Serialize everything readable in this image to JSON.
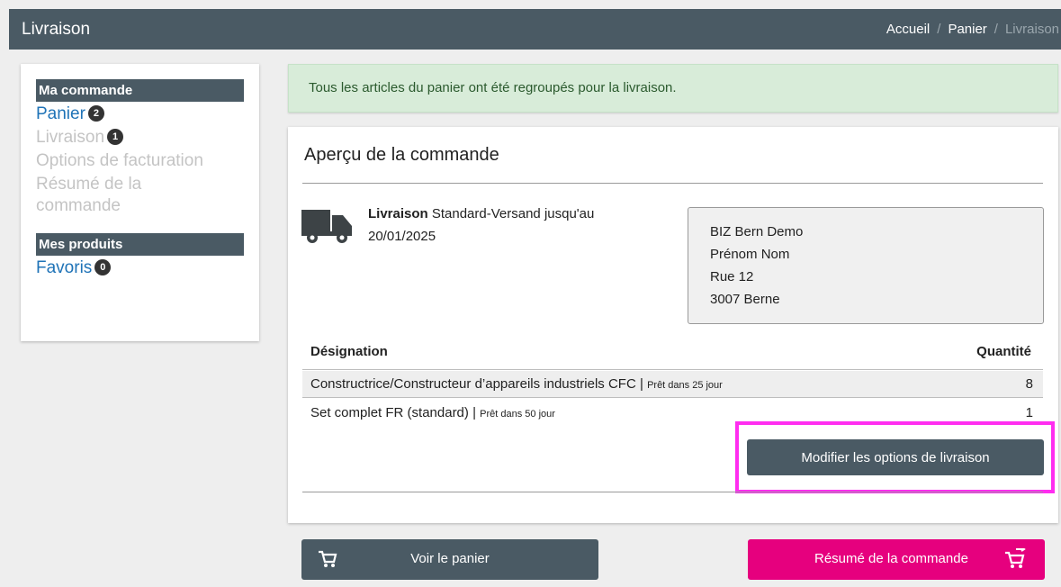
{
  "header": {
    "title": "Livraison",
    "breadcrumb": [
      "Accueil",
      "Panier",
      "Livraison"
    ],
    "separator": "/"
  },
  "sidebar": {
    "section1": "Ma commande",
    "items": [
      {
        "label": "Panier",
        "badge": "2",
        "state": "active"
      },
      {
        "label": "Livraison",
        "badge": "1",
        "state": "disabled"
      },
      {
        "label": "Options de facturation",
        "state": "disabled"
      },
      {
        "label": "Résumé de la commande",
        "state": "disabled"
      }
    ],
    "section2": "Mes produits",
    "products": [
      {
        "label": "Favoris",
        "badge": "0",
        "state": "active"
      }
    ]
  },
  "alert": {
    "text": "Tous les articles du panier ont été regroupés pour la livraison."
  },
  "overview": {
    "title": "Aperçu de la commande",
    "shipping_label": "Livraison",
    "shipping_text": "Standard-Versand jusqu'au",
    "shipping_date": "20/01/2025",
    "address": [
      "BIZ Bern Demo",
      "Prénom Nom",
      "Rue 12",
      "3007 Berne"
    ],
    "columns": {
      "designation": "Désignation",
      "quantity": "Quantité"
    },
    "rows": [
      {
        "name": "Constructrice/Constructeur d’appareils industriels CFC",
        "sep": "|",
        "note": "Prêt dans 25 jour",
        "qty": "8"
      },
      {
        "name": "Set complet FR (standard)",
        "sep": "|",
        "note": "Prêt dans 50 jour",
        "qty": "1"
      }
    ],
    "modify_button": "Modifier les options de livraison"
  },
  "footer": {
    "cart_button": "Voir le panier",
    "summary_button": "Résumé de la commande"
  },
  "colors": {
    "primary": "#4a5a64",
    "accent": "#e6007e",
    "link": "#1f73b7",
    "highlight": "#ff2df0"
  }
}
